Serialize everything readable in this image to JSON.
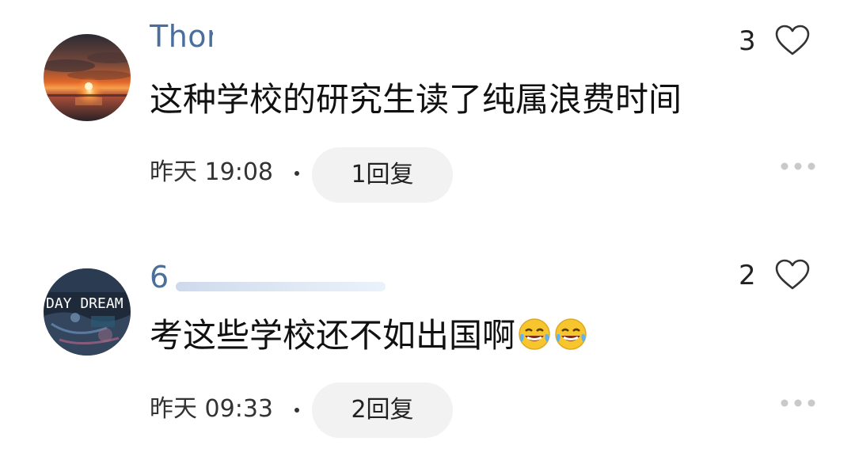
{
  "comments": [
    {
      "username": "Thor",
      "text": "这种学校的研究生读了纯属浪费时间",
      "likes": "3",
      "time": "昨天 19:08",
      "reply_label": "1回复",
      "avatar": "sunset-avatar"
    },
    {
      "username": "6",
      "text": "考这些学校还不如出国啊",
      "emojis": [
        "tears-of-joy",
        "tears-of-joy"
      ],
      "likes": "2",
      "time": "昨天 09:33",
      "reply_label": "2回复",
      "avatar_text": "DAY DREAM"
    }
  ],
  "icons": {
    "like": "heart-outline-icon",
    "more": "more-dots-icon"
  },
  "colors": {
    "username": "#4a6f9c",
    "reply_bg": "#f2f2f2",
    "text": "#111111"
  }
}
